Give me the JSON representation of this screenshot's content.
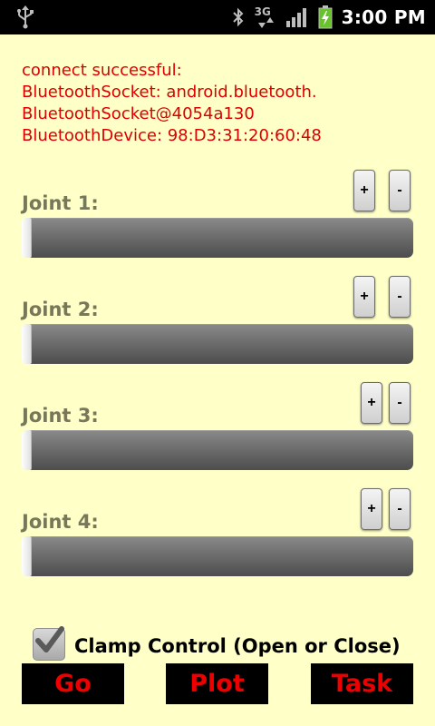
{
  "status_bar": {
    "time": "3:00 PM",
    "network_type": "3G",
    "icons": [
      "usb-icon",
      "bluetooth-icon",
      "3g-data-icon",
      "signal-icon",
      "battery-charging-icon"
    ]
  },
  "connection_status": {
    "lines": [
      "connect successful:",
      "BluetoothSocket: android.bluetooth.",
      "BluetoothSocket@4054a130",
      "BluetoothDevice: 98:D3:31:20:60:48"
    ],
    "color": "#DD0000"
  },
  "joints": [
    {
      "label": "Joint 1:",
      "plus": "+",
      "minus": "-",
      "value": 0
    },
    {
      "label": "Joint 2:",
      "plus": "+",
      "minus": "-",
      "value": 0
    },
    {
      "label": "Joint 3:",
      "plus": "+",
      "minus": "-",
      "value": 0
    },
    {
      "label": "Joint 4:",
      "plus": "+",
      "minus": "-",
      "value": 0
    }
  ],
  "clamp": {
    "label": "Clamp Control (Open or Close)",
    "checked": true
  },
  "actions": {
    "go": "Go",
    "plot": "Plot",
    "task": "Task"
  },
  "colors": {
    "background": "#FFFFC8",
    "accent_red": "#EE0000",
    "label_olive": "#77775A"
  }
}
